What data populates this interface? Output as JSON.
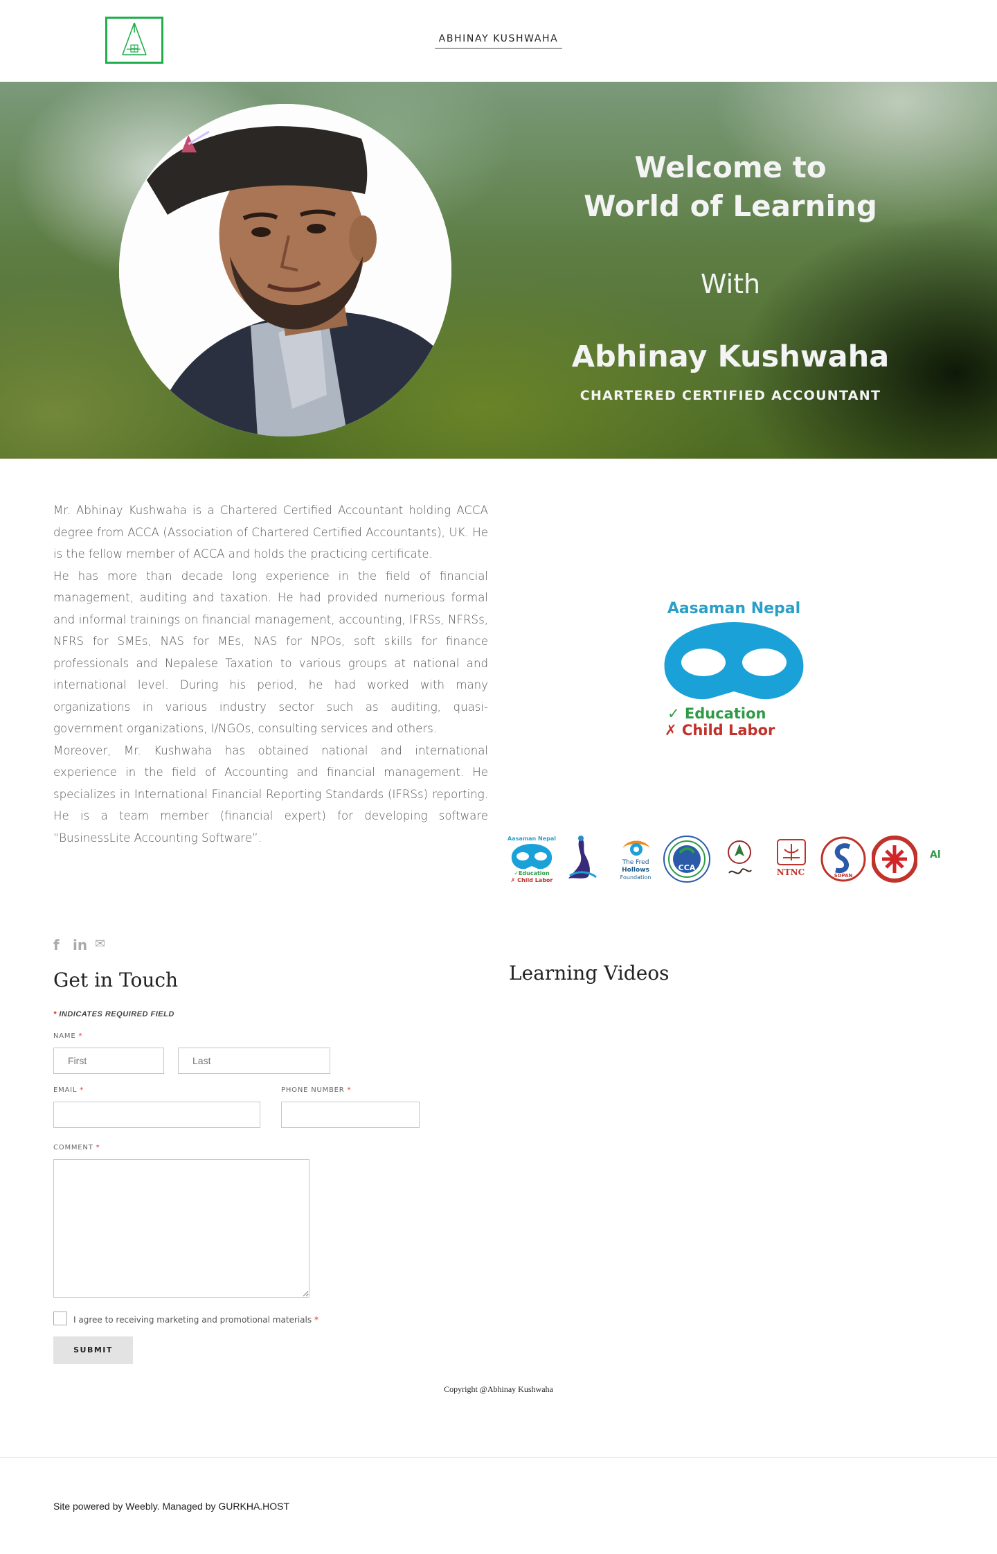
{
  "header": {
    "site_title": "ABHINAY KUSHWAHA",
    "logo_icon": "house-logo-icon",
    "logo_color": "#1fae4b"
  },
  "hero": {
    "welcome_line1": "Welcome to",
    "welcome_line2": "World of Learning",
    "with": "With",
    "name": "Abhinay Kushwaha",
    "role": "CHARTERED CERTIFIED ACCOUNTANT",
    "portrait_icon": "profile-photo"
  },
  "about": {
    "paragraphs": [
      "Mr. Abhinay Kushwaha is a Chartered Certified Accountant holding ACCA degree from ACCA (Association of Chartered Certified Accountants), UK. He is the fellow member of ACCA and holds the practicing certificate.",
      "He has more than decade long experience in the field of financial management, auditing and taxation. He had provided numerious formal and informal trainings on financial management, accounting, IFRSs, NFRSs, NFRS for SMEs, NAS for MEs, NAS for NPOs, soft skills for finance professionals and Nepalese Taxation to various groups at national and international level. During his period, he had worked with many organizations in various industry sector such as auditing, quasi-government organizations, I/NGOs, consulting services and others.",
      "Moreover, Mr. Kushwaha has obtained national and international experience in the field of Accounting and financial management. He specializes in International Financial Reporting Standards (IFRSs) reporting. He is a team member (financial expert) for developing software “BusinessLite Accounting Software”."
    ]
  },
  "ngo_logo": {
    "title": "Aasaman Nepal",
    "line1": "✓ Education",
    "line2": "✗ Child Labor",
    "color_blue": "#2aa0c8",
    "color_green": "#2e9a46",
    "color_red": "#c0322a"
  },
  "partners": {
    "aasaman_title": "Aasaman Nepal",
    "aasaman_line1": "✓Education",
    "aasaman_line2": "✗ Child Labor",
    "fred_line1": "The Fred",
    "fred_line2": "Hollows",
    "fred_line3": "Foundation",
    "cca": "CCA",
    "ntnc": "NTNC",
    "sopan": "SOPAN",
    "caritas_icon": "caritas-logo-icon",
    "partial": "Al"
  },
  "social": {
    "facebook_icon": "facebook-icon",
    "linkedin_icon": "linkedin-icon",
    "email_icon": "mail-icon",
    "facebook_glyph": "f",
    "linkedin_glyph": "in",
    "email_glyph": "✉"
  },
  "contact": {
    "title": "Get in Touch",
    "required_star": "*",
    "required_note": "INDICATES REQUIRED FIELD",
    "name_label": "NAME",
    "first_placeholder": "First",
    "last_placeholder": "Last",
    "email_label": "EMAIL",
    "phone_label": "PHONE NUMBER",
    "comment_label": "COMMENT",
    "consent_label": "I agree to receiving marketing and promotional materials",
    "submit_label": "SUBMIT"
  },
  "videos": {
    "title": "Learning Videos"
  },
  "footer": {
    "copyright": "Copyright @Abhinay Kushwaha",
    "powered": "Site powered by Weebly. Managed by GURKHA.HOST"
  }
}
